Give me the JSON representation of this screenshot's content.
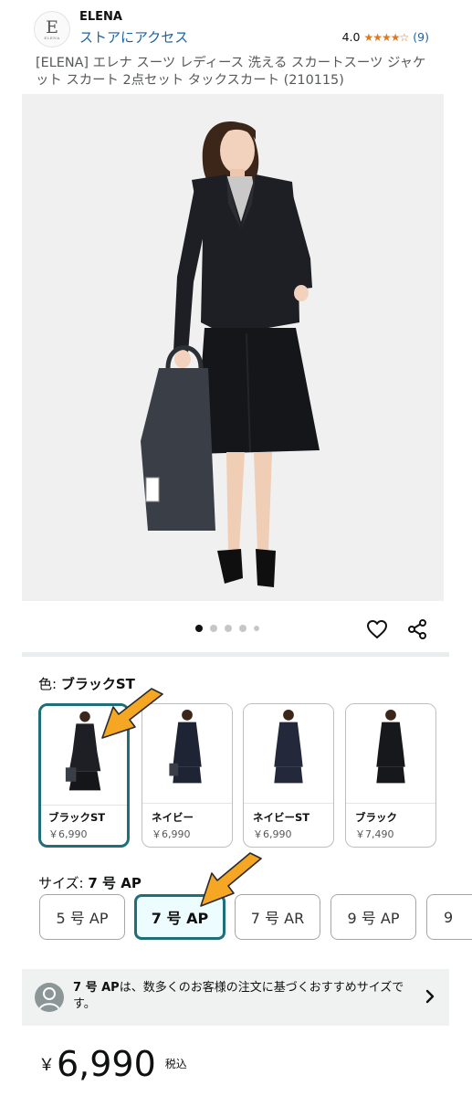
{
  "header": {
    "brand": "ELENA",
    "logo_letter": "E",
    "logo_text": "ELENA",
    "store_link": "ストアにアクセス",
    "rating_value": "4.0",
    "rating_stars": 4,
    "rating_count": "(9)"
  },
  "product": {
    "title": "[ELENA] エレナ スーツ レディース 洗える スカートスーツ ジャケット スカート 2点セット タックスカート (210115)",
    "image_count": 5,
    "active_image": 0
  },
  "icons": {
    "favorite": "heart-icon",
    "share": "share-icon",
    "more": "chevron-right-icon",
    "user": "user-icon"
  },
  "color": {
    "label": "色: ",
    "selected": "ブラックST",
    "swatches": [
      {
        "name": "ブラックST",
        "price": "￥6,990",
        "suit_color": "#1d1f24"
      },
      {
        "name": "ネイビー",
        "price": "￥6,990",
        "suit_color": "#1e2433"
      },
      {
        "name": "ネイビーST",
        "price": "￥6,990",
        "suit_color": "#23293a"
      },
      {
        "name": "ブラック",
        "price": "￥7,490",
        "suit_color": "#17181b"
      }
    ]
  },
  "size": {
    "label": "サイズ: ",
    "selected": "7 号 AP",
    "options": [
      "5 号 AP",
      "7 号 AP",
      "7 号 AR",
      "9 号 AP",
      "9"
    ]
  },
  "recommendation": {
    "highlight": "7 号 AP",
    "text": "は、数多くのお客様の注文に基づくおすすめサイズです。"
  },
  "price": {
    "symbol": "￥",
    "whole": "6,990",
    "tax": "税込"
  },
  "colors": {
    "link": "#2162a1",
    "star": "#de7921",
    "selected_border": "#1e6f78",
    "selected_bg": "#edfdff",
    "annotation_arrow": "#f5a623"
  }
}
